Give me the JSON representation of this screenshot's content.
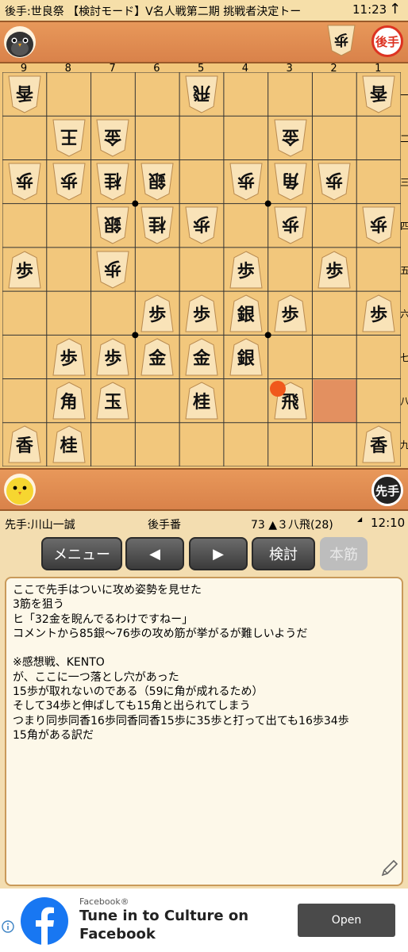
{
  "topbar": {
    "title": "後手:世良祭 【検討モード】V名人戦第二期 挑戦者決定トー",
    "time": "11:23",
    "up_icon": "up-arrow-icon"
  },
  "gote_hand": {
    "avatar_icon": "penguin-avatar-icon",
    "pieces": [
      {
        "char": "歩",
        "count": "1"
      }
    ],
    "turn_badge": "後手"
  },
  "sente_hand": {
    "avatar_icon": "chick-avatar-icon",
    "turn_badge": "先手"
  },
  "board": {
    "file_labels": [
      "9",
      "8",
      "7",
      "6",
      "5",
      "4",
      "3",
      "2",
      "1"
    ],
    "rank_labels": [
      "一",
      "二",
      "三",
      "四",
      "五",
      "六",
      "七",
      "八",
      "九"
    ],
    "last_move_square": "2八",
    "moved_piece_marker": "3八",
    "pieces": [
      {
        "square": "9一",
        "char": "香",
        "owner": "gote"
      },
      {
        "square": "5一",
        "char": "飛",
        "owner": "gote"
      },
      {
        "square": "1一",
        "char": "香",
        "owner": "gote"
      },
      {
        "square": "8二",
        "char": "王",
        "owner": "gote"
      },
      {
        "square": "7二",
        "char": "金",
        "owner": "gote"
      },
      {
        "square": "3二",
        "char": "金",
        "owner": "gote"
      },
      {
        "square": "9三",
        "char": "歩",
        "owner": "gote"
      },
      {
        "square": "8三",
        "char": "歩",
        "owner": "gote"
      },
      {
        "square": "7三",
        "char": "桂",
        "owner": "gote"
      },
      {
        "square": "6三",
        "char": "銀",
        "owner": "gote"
      },
      {
        "square": "4三",
        "char": "歩",
        "owner": "gote"
      },
      {
        "square": "3三",
        "char": "角",
        "owner": "gote"
      },
      {
        "square": "2三",
        "char": "歩",
        "owner": "gote"
      },
      {
        "square": "7四",
        "char": "銀",
        "owner": "gote"
      },
      {
        "square": "6四",
        "char": "桂",
        "owner": "gote"
      },
      {
        "square": "5四",
        "char": "歩",
        "owner": "gote"
      },
      {
        "square": "3四",
        "char": "歩",
        "owner": "gote"
      },
      {
        "square": "1四",
        "char": "歩",
        "owner": "gote"
      },
      {
        "square": "7五",
        "char": "歩",
        "owner": "gote"
      },
      {
        "square": "9五",
        "char": "歩",
        "owner": "sente"
      },
      {
        "square": "4五",
        "char": "歩",
        "owner": "sente"
      },
      {
        "square": "2五",
        "char": "歩",
        "owner": "sente"
      },
      {
        "square": "6六",
        "char": "歩",
        "owner": "sente"
      },
      {
        "square": "5六",
        "char": "歩",
        "owner": "sente"
      },
      {
        "square": "4六",
        "char": "銀",
        "owner": "sente"
      },
      {
        "square": "3六",
        "char": "歩",
        "owner": "sente"
      },
      {
        "square": "1六",
        "char": "歩",
        "owner": "sente"
      },
      {
        "square": "8七",
        "char": "歩",
        "owner": "sente"
      },
      {
        "square": "7七",
        "char": "歩",
        "owner": "sente"
      },
      {
        "square": "6七",
        "char": "金",
        "owner": "sente"
      },
      {
        "square": "5七",
        "char": "金",
        "owner": "sente"
      },
      {
        "square": "4七",
        "char": "銀",
        "owner": "sente"
      },
      {
        "square": "8八",
        "char": "角",
        "owner": "sente"
      },
      {
        "square": "7八",
        "char": "玉",
        "owner": "sente"
      },
      {
        "square": "5八",
        "char": "桂",
        "owner": "sente"
      },
      {
        "square": "3八",
        "char": "飛",
        "owner": "sente"
      },
      {
        "square": "9九",
        "char": "香",
        "owner": "sente"
      },
      {
        "square": "8九",
        "char": "桂",
        "owner": "sente"
      },
      {
        "square": "1九",
        "char": "香",
        "owner": "sente"
      }
    ]
  },
  "info": {
    "sente_player": "先手:川山一誠",
    "turn": "後手番",
    "move": "73 ▲３八飛(28)",
    "time": "12:10"
  },
  "buttons": {
    "menu": "メニュー",
    "prev": "◀",
    "next": "▶",
    "analyze": "検討",
    "mainline": "本筋"
  },
  "comment": {
    "lines": [
      "ここで先手はついに攻め姿勢を見せた",
      "3筋を狙う",
      "ヒ「32金を睨んでるわけですねー」",
      "コメントから85銀〜76歩の攻め筋が挙がるが難しいようだ",
      "",
      "※感想戦、KENTO",
      "が、ここに一つ落とし穴があった",
      "15歩が取れないのである（59に角が成れるため）",
      "そして34歩と伸ばしても15角と出られてしまう",
      "つまり同歩同香16歩同香同香15歩に35歩と打って出ても16歩34歩",
      "15角がある訳だ"
    ],
    "edit_icon": "pencil-icon"
  },
  "ad": {
    "source": "Facebook®",
    "headline_line1": "Tune in to Culture on",
    "headline_line2": "Facebook",
    "cta": "Open",
    "info_icon": "info-icon",
    "logo_icon": "facebook-logo-icon"
  }
}
